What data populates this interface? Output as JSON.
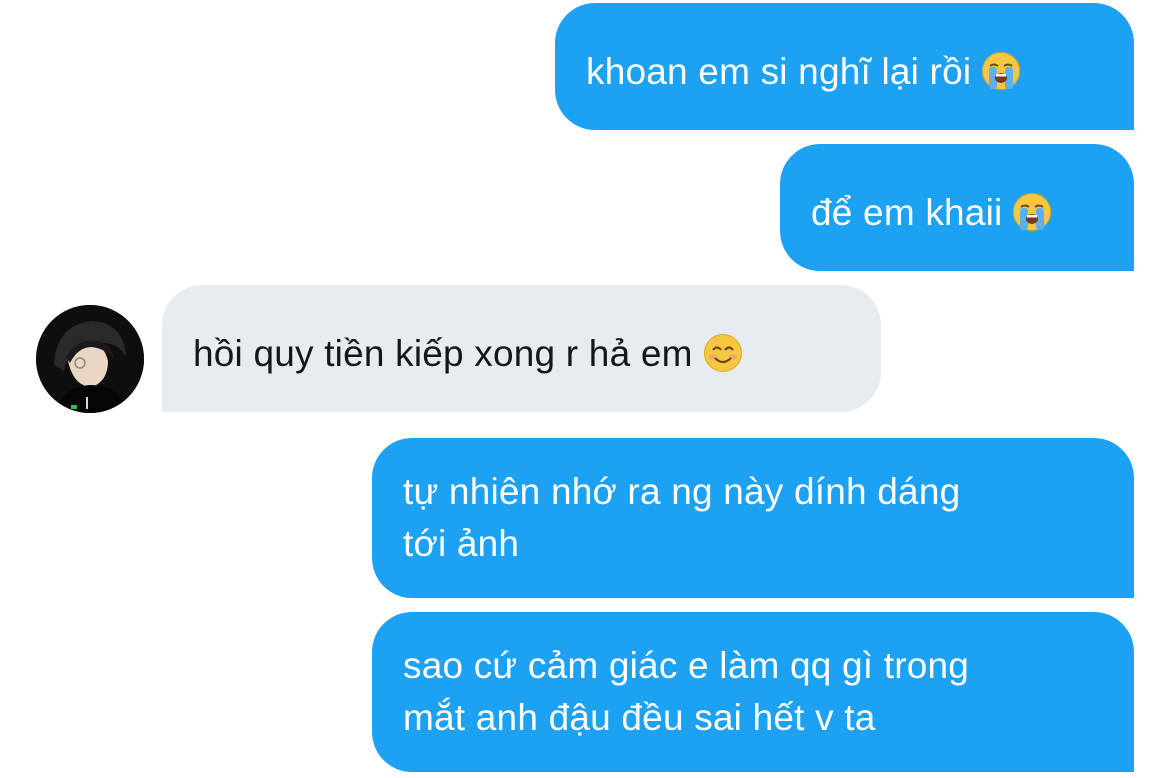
{
  "conversation": {
    "messages": [
      {
        "text": "khoan em si nghĩ lại rồi",
        "sender": "me",
        "emoji": "loudly-crying-face"
      },
      {
        "text": "để em khaii",
        "sender": "me",
        "emoji": "loudly-crying-face"
      },
      {
        "text": "hồi quy tiền kiếp xong r hả em",
        "sender": "other",
        "emoji": "smiling-face-with-smiling-eyes"
      },
      {
        "line1": "tự nhiên nhớ ra ng này dính dáng",
        "line2": "tới ảnh",
        "sender": "me"
      },
      {
        "line1": "sao cứ cảm giác e làm qq gì trong",
        "line2": "mắt anh đậu đều sai hết v ta",
        "sender": "me"
      }
    ]
  },
  "colors": {
    "sent_bubble": "#1da1f2",
    "received_bubble": "#e6ecf0",
    "sent_text": "#ffffff",
    "received_text": "#14171a"
  }
}
